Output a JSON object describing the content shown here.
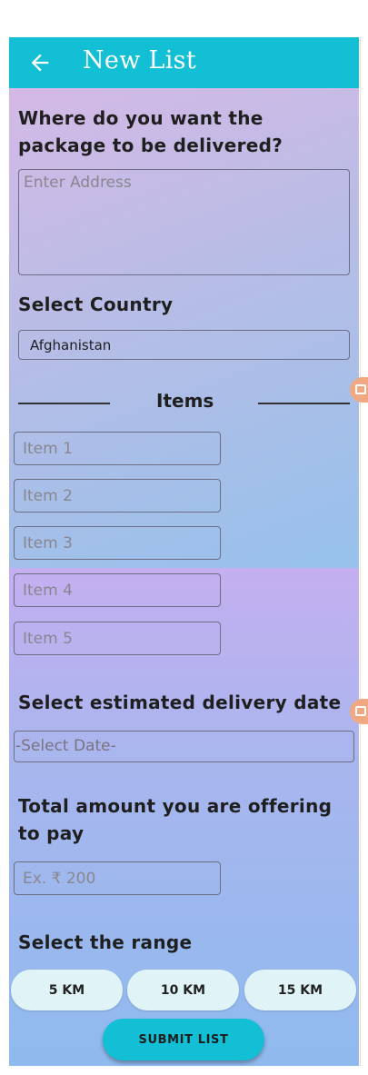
{
  "header": {
    "title": "New List",
    "back_icon": "arrow-left-icon"
  },
  "address": {
    "heading": "Where do you want the package to be delivered?",
    "placeholder": "Enter Address"
  },
  "country": {
    "heading": "Select Country",
    "selected": "Afghanistan"
  },
  "items": {
    "heading": "Items",
    "placeholders": [
      "Item 1",
      "Item 2",
      "Item 3",
      "Item 4",
      "Item 5"
    ]
  },
  "delivery_date": {
    "heading": "Select estimated delivery date",
    "placeholder": "-Select Date-"
  },
  "amount": {
    "heading": "Total amount you are offering to pay",
    "placeholder": "Ex. ₹ 200"
  },
  "range": {
    "heading": "Select the range",
    "options": [
      "5 KM",
      "10 KM",
      "15 KM"
    ]
  },
  "submit_label": "SUBMIT LIST",
  "colors": {
    "accent": "#12bfd4",
    "range_button": "#e0f4f8",
    "side_badge": "#f0a882"
  }
}
